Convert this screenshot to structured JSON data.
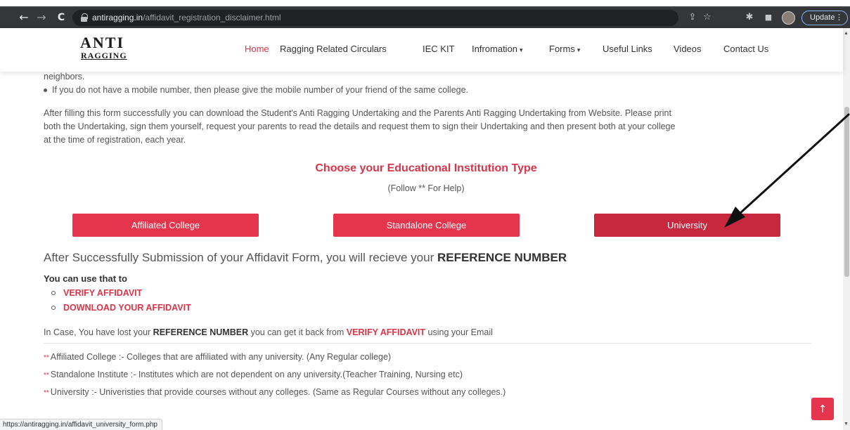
{
  "browser": {
    "url_host": "antiragging.in",
    "url_path": "/affidavit_registration_disclaimer.html",
    "update_label": "Update",
    "status_url": "https://antiragging.in/affidavit_university_form.php"
  },
  "logo": {
    "top": "ANTI",
    "bottom": "RAGGING"
  },
  "nav": {
    "home": "Home",
    "circulars": "Ragging Related Circulars",
    "iec": "IEC KIT",
    "information": "Infromation",
    "forms": "Forms",
    "useful_links": "Useful Links",
    "videos": "Videos",
    "contact": "Contact Us"
  },
  "content": {
    "bullet_partial": "neighbors.",
    "bullet_mobile": "If you do not have a mobile number, then please give the mobile number of your friend of the same college.",
    "para_line1": "After filling this form successfully you can download the Student's Anti Ragging Undertaking and the Parents Anti Ragging Undertaking from Website. Please print",
    "para_line2": "both the Undertaking, sign them yourself, request your parents to read the details and request them to sign their Undertaking and then present both at your college",
    "para_line3": "at the time of registration, each year.",
    "choose_heading": "Choose your Educational Institution Type",
    "help_text": "(Follow ** For Help)",
    "btn_affiliated": "Affiliated College",
    "btn_standalone": "Standalone College",
    "btn_university": "University",
    "submission_text": "After Successfully Submission of your Affidavit Form, you will recieve your ",
    "reference_number": "REFERENCE NUMBER",
    "can_use": "You can use that to",
    "link_verify": "VERIFY AFFIDAVIT",
    "link_download": "DOWNLOAD YOUR AFFIDAVIT",
    "incase_prefix": "In Case, You have lost your ",
    "incase_mid": " you can get it back from ",
    "incase_suffix": " using your Email",
    "note_stars": "**",
    "note_affiliated": "Affiliated College :- Colleges that are affiliated with any university. (Any Regular college)",
    "note_standalone": "Standalone Institute :- Institutes which are not dependent on any university.(Teacher Training, Nursing etc)",
    "note_university": "University :- Univeristies that provide courses without any colleges. (Same as Regular Courses without any colleges.)"
  },
  "colors": {
    "accent": "#e5354d",
    "accent_dark": "#c8283e",
    "link": "#d9354a"
  },
  "icons": {
    "back": "←",
    "forward": "→",
    "reload": "C",
    "share": "⇪",
    "star": "☆",
    "puzzle": "✱",
    "panel": "■",
    "dots": "⋮",
    "caret": "▾",
    "back_to_top": "↑"
  }
}
